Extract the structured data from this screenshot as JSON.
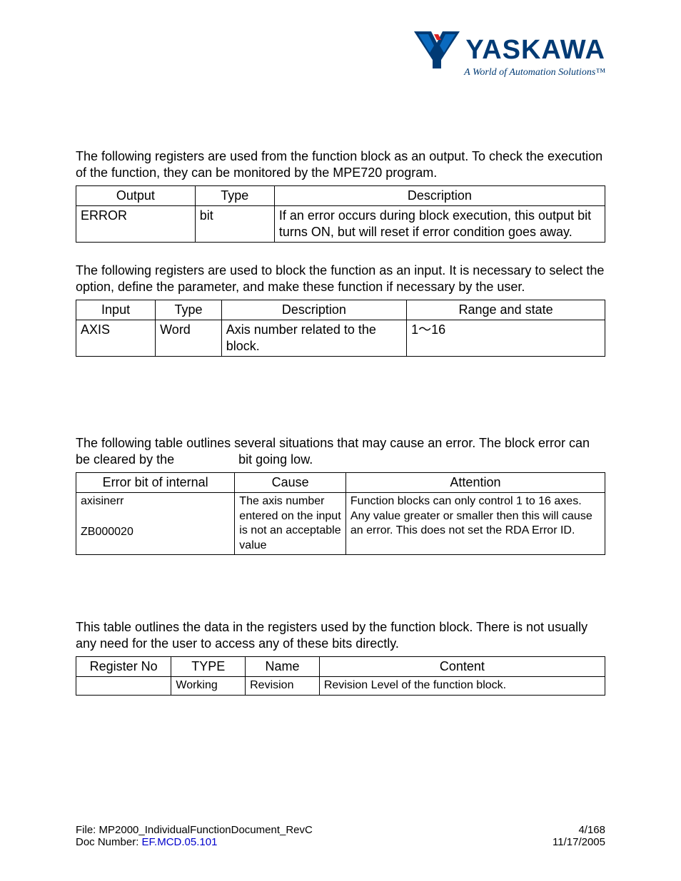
{
  "logo": {
    "name": "YASKAWA",
    "tagline": "A World of Automation Solutions™"
  },
  "section1": {
    "intro": "The following registers are used from the function block as an output.  To check the execution of the function, they can be monitored by the MPE720 program.",
    "headers": {
      "c0": "Output",
      "c1": "Type",
      "c2": "Description"
    },
    "row": {
      "c0": "ERROR",
      "c1": "bit",
      "c2": "If an error occurs during block execution, this output bit turns ON, but will reset if error condition goes away."
    }
  },
  "section2": {
    "intro": "The following registers are used to block the function as an input.  It is necessary to select the option, define the parameter, and make these function if necessary by the user.",
    "headers": {
      "c0": "Input",
      "c1": "Type",
      "c2": "Description",
      "c3": "Range and state"
    },
    "row": {
      "c0": "AXIS",
      "c1": "Word",
      "c2": "Axis number related to the block.",
      "c3": "1～16"
    }
  },
  "section3": {
    "intro_a": "The following table outlines several situations that may cause an error.  The block error can be cleared by the ",
    "intro_b": " bit going low.",
    "headers": {
      "c0": "Error bit of internal",
      "c1": "Cause",
      "c2": "Attention"
    },
    "row": {
      "c0a": "axisinerr",
      "c0b": "ZB000020",
      "c1": "The axis number entered on the input is not an acceptable value",
      "c2": "Function blocks can only control 1 to 16 axes.  Any value greater or smaller then this will cause an error.  This does not set the RDA Error ID."
    }
  },
  "section4": {
    "intro": "This table outlines the data in the registers used by the function block.  There is not usually any need for the user to access any of these bits directly.",
    "headers": {
      "c0": "Register No",
      "c1": "TYPE",
      "c2": "Name",
      "c3": "Content"
    },
    "row": {
      "c0": "",
      "c1": "Working",
      "c2": "Revision",
      "c3": "Revision Level of the function block."
    }
  },
  "footer": {
    "file_label": "File:  ",
    "file_value": "MP2000_IndividualFunctionDocument_RevC",
    "docnum_label": "Doc Number:  ",
    "docnum_value": "EF.MCD.05.101",
    "page": "4/168",
    "date": "11/17/2005"
  }
}
